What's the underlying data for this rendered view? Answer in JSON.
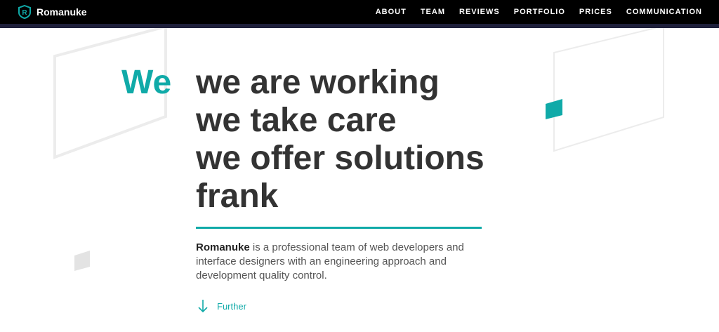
{
  "brand": {
    "name": "Romanuke"
  },
  "nav": {
    "items": [
      "ABOUT",
      "TEAM",
      "REVIEWS",
      "PORTFOLIO",
      "PRICES",
      "COMMUNICATION"
    ]
  },
  "hero": {
    "lead": "We",
    "lines": [
      "we are working",
      "we take care",
      "we offer solutions",
      "frank"
    ]
  },
  "description": {
    "brand": "Romanuke",
    "text": " is a professional team of web developers and interface designers with an engineering approach and development quality control."
  },
  "further": {
    "label": "Further"
  },
  "colors": {
    "accent": "#10aaa8",
    "nav_bg": "#000000",
    "heading": "#333333"
  },
  "icons": {
    "logo": "shield-r-icon",
    "further": "arrow-down-icon"
  }
}
